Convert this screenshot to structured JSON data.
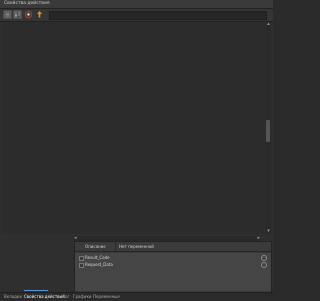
{
  "window": {
    "title": "Свойства действия"
  },
  "toolbar": {
    "buttons": [
      {
        "name": "properties-icon",
        "tooltip": ""
      },
      {
        "name": "sort-icon",
        "tooltip": ""
      },
      {
        "name": "help-icon",
        "tooltip": ""
      },
      {
        "name": "pin-icon",
        "tooltip": ""
      }
    ],
    "search_value": "",
    "accent": "#e0902a"
  },
  "properties": {
    "description_label": "Описание",
    "description_value": "Нет переменной",
    "items": [
      {
        "label": "Result_Code"
      },
      {
        "label": "Request_Data"
      }
    ]
  },
  "tabs": [
    {
      "label": "Вкладки"
    },
    {
      "label": "Свойства действия"
    },
    {
      "label": "Лог"
    },
    {
      "label": "Графики"
    },
    {
      "label": "Переменные"
    }
  ]
}
